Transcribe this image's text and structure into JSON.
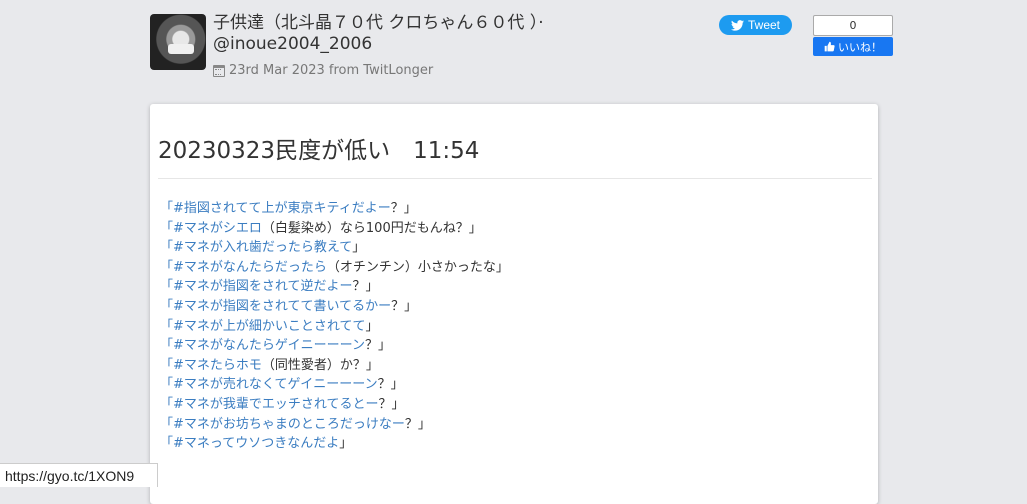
{
  "header": {
    "title_line1": "子供達（北斗晶７０代 クロちゃん６０代 ）·",
    "title_line2": "@inoue2004_2006",
    "date_text": "23rd Mar 2023 from TwitLonger"
  },
  "share": {
    "tweet_label": "Tweet",
    "like_count": "0",
    "like_label": "いいね！"
  },
  "post": {
    "title": "20230323民度が低い　11:54",
    "lines": [
      [
        {
          "t": "「#指図されてて上が東京キティだよー",
          "c": "tag"
        },
        {
          "t": "？」",
          "c": "plain"
        }
      ],
      [
        {
          "t": "「#マネがシエロ",
          "c": "tag"
        },
        {
          "t": "（白髪染め）なら100円だもんね？」",
          "c": "plain"
        }
      ],
      [
        {
          "t": "「#マネが入れ歯だったら教えて",
          "c": "tag"
        },
        {
          "t": "」",
          "c": "plain"
        }
      ],
      [
        {
          "t": "「#マネがなんたらだったら",
          "c": "tag"
        },
        {
          "t": "（オチンチン）小さかったな」",
          "c": "plain"
        }
      ],
      [
        {
          "t": "「#マネが指図をされて逆だよー",
          "c": "tag"
        },
        {
          "t": "？」",
          "c": "plain"
        }
      ],
      [
        {
          "t": "「#マネが指図をされてて書いてるかー",
          "c": "tag"
        },
        {
          "t": "？」",
          "c": "plain"
        }
      ],
      [
        {
          "t": "「#マネが上が細かいことされてて",
          "c": "tag"
        },
        {
          "t": "」",
          "c": "plain"
        }
      ],
      [
        {
          "t": "「#マネがなんたらゲイニーーーン",
          "c": "tag"
        },
        {
          "t": "？」",
          "c": "plain"
        }
      ],
      [
        {
          "t": "「#マネたらホモ",
          "c": "tag"
        },
        {
          "t": "（同性愛者）か？」",
          "c": "plain"
        }
      ],
      [
        {
          "t": "「#マネが売れなくてゲイニーーーン",
          "c": "tag"
        },
        {
          "t": "？」",
          "c": "plain"
        }
      ],
      [
        {
          "t": "「#マネが我輩でエッチされてるとー",
          "c": "tag"
        },
        {
          "t": "？」",
          "c": "plain"
        }
      ],
      [
        {
          "t": "「#マネがお坊ちゃまのところだっけなー",
          "c": "tag"
        },
        {
          "t": "？」",
          "c": "plain"
        }
      ],
      [
        {
          "t": "「#マネってウソつきなんだよ",
          "c": "tag"
        },
        {
          "t": "」",
          "c": "plain"
        }
      ]
    ]
  },
  "status_bar": {
    "url": "https://gyo.tc/1XON9"
  },
  "colors": {
    "link": "#3b7dc1",
    "tweet": "#1d9bf0",
    "facebook": "#1877f2"
  },
  "icons": [
    "calendar-icon",
    "twitter-bird-icon",
    "thumbs-up-icon"
  ]
}
